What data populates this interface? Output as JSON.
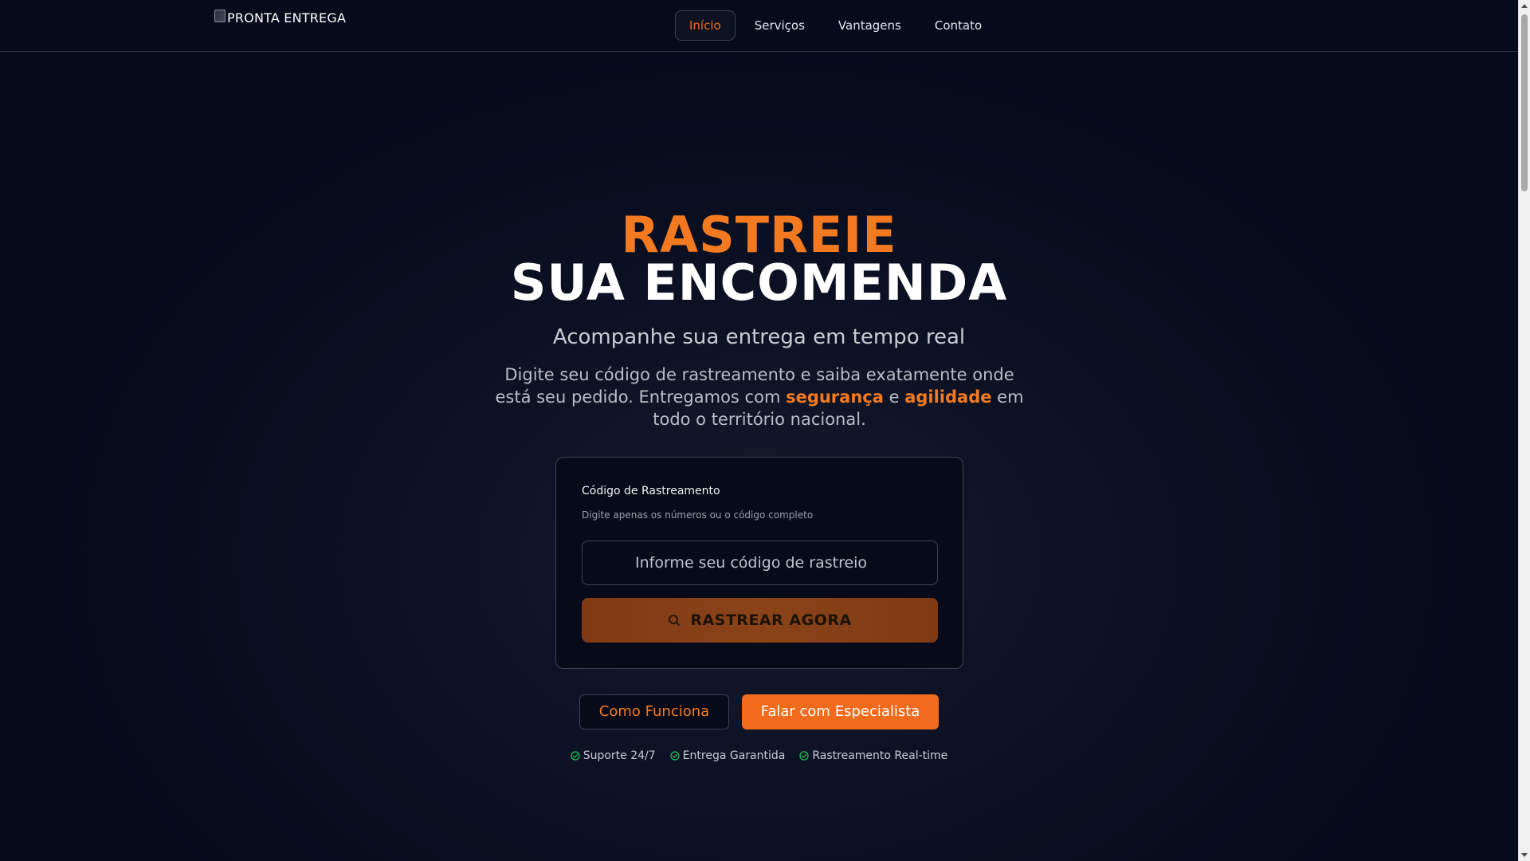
{
  "brand": {
    "logo_alt": "PRONTA ENTREGA"
  },
  "nav": {
    "items": [
      {
        "label": "Início",
        "active": true
      },
      {
        "label": "Serviços",
        "active": false
      },
      {
        "label": "Vantagens",
        "active": false
      },
      {
        "label": "Contato",
        "active": false
      }
    ]
  },
  "hero": {
    "title_line1": "RASTREIE",
    "title_line2": "SUA ENCOMENDA",
    "subtitle": "Acompanhe sua entrega em tempo real",
    "desc_part1": "Digite seu código de rastreamento e saiba exatamente onde está seu pedido. Entregamos com ",
    "desc_highlight1": "segurança",
    "desc_part2": " e ",
    "desc_highlight2": "agilidade",
    "desc_part3": " em todo o território nacional."
  },
  "tracking": {
    "label": "Código de Rastreamento",
    "hint": "Digite apenas os números ou o código completo",
    "input_value": "",
    "placeholder": "Informe seu código de rastreio",
    "button_label": "RASTREAR AGORA"
  },
  "actions": {
    "secondary_label": "Como Funciona",
    "primary_label": "Falar com Especialista"
  },
  "features": [
    {
      "label": "Suporte 24/7",
      "icon": "check-circle-icon"
    },
    {
      "label": "Entrega Garantida",
      "icon": "check-circle-icon"
    },
    {
      "label": "Rastreamento Real-time",
      "icon": "check-circle-icon"
    }
  ],
  "colors": {
    "accent": "#f47a22",
    "background": "#060a1b",
    "check": "#22c55e"
  }
}
